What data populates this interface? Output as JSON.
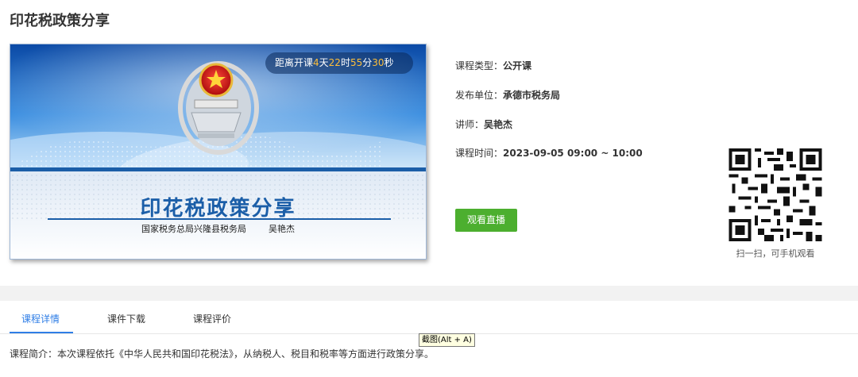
{
  "page": {
    "title": "印花税政策分享"
  },
  "cover": {
    "countdown": {
      "prefix": "距离开课",
      "days": "4",
      "days_unit": "天",
      "hours": "22",
      "hours_unit": "时",
      "minutes": "55",
      "minutes_unit": "分",
      "seconds": "30",
      "seconds_unit": "秒"
    },
    "title": "印花税政策分享",
    "org": "国家税务总局兴隆县税务局",
    "speaker": "吴艳杰"
  },
  "info": {
    "type": {
      "label": "课程类型：",
      "value": "公开课"
    },
    "publisher": {
      "label": "发布单位：",
      "value": "承德市税务局"
    },
    "teacher": {
      "label": "讲师：",
      "value": "吴艳杰"
    },
    "time": {
      "label": "课程时间：",
      "value": "2023-09-05 09:00 ~ 10:00"
    }
  },
  "watch_button": "观看直播",
  "qr": {
    "caption": "扫一扫，可手机观看"
  },
  "tabs": [
    {
      "label": "课程详情"
    },
    {
      "label": "课件下载"
    },
    {
      "label": "课程评价"
    }
  ],
  "tooltip": "截图(Alt + A)",
  "summary": "课程简介：本次课程依托《中华人民共和国印花税法》，从纳税人、税目和税率等方面进行政策分享。",
  "colors": {
    "accent": "#2f7ee6",
    "button": "#4caf2f",
    "countdown_num": "#ffbf3a",
    "cover_title": "#1b5ea8"
  }
}
